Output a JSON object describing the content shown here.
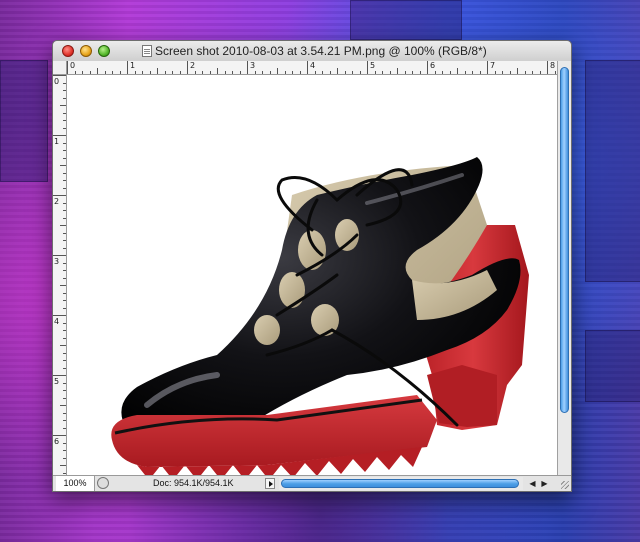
{
  "window": {
    "title": "Screen shot 2010-08-03 at 3.54.21 PM.png @ 100% (RGB/8*)"
  },
  "rulers": {
    "top_labels": [
      "0",
      "1",
      "2",
      "3",
      "4",
      "5",
      "6",
      "7",
      "8"
    ],
    "left_labels": [
      "0",
      "1",
      "2",
      "3",
      "4",
      "5",
      "6"
    ]
  },
  "status": {
    "zoom": "100%",
    "doc_size": "Doc: 954.1K/954.1K"
  },
  "image": {
    "subject": "shoe",
    "colors": {
      "upper": "#0b0b0d",
      "sole": "#c8262c",
      "lining": "#c9bc9e",
      "background": "#ffffff"
    }
  }
}
